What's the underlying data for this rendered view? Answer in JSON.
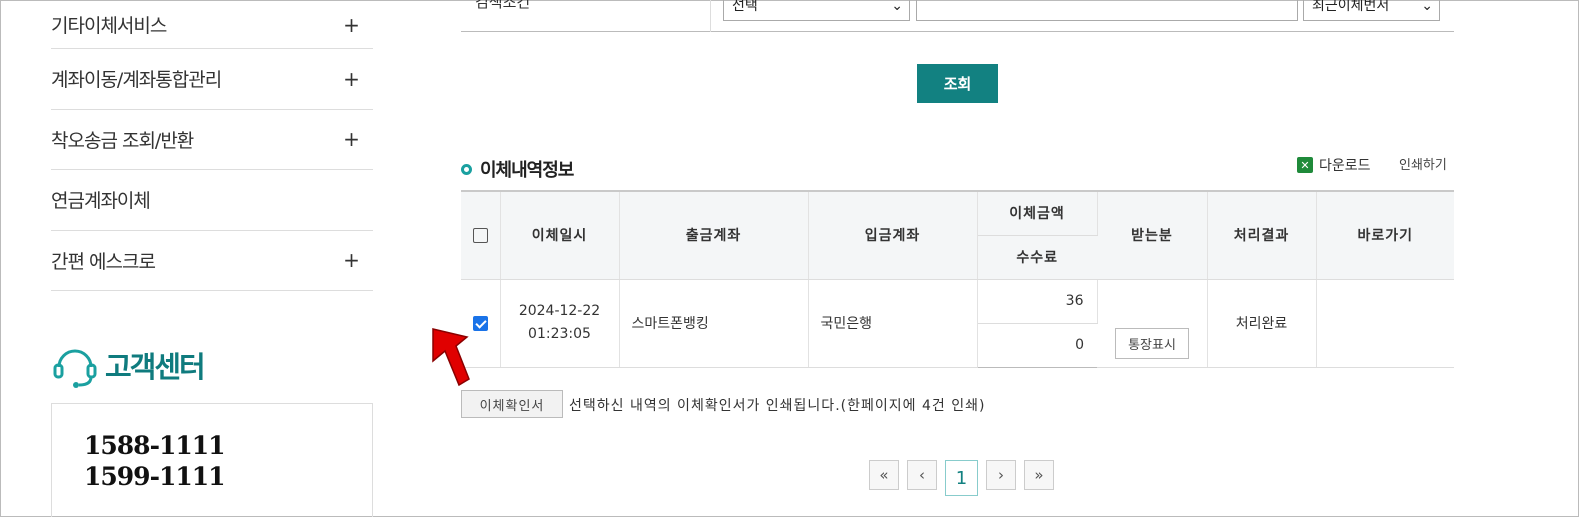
{
  "sidebar": {
    "items": [
      {
        "label": "기타이체서비스",
        "plus": "+"
      },
      {
        "label": "계좌이동/계좌통합관리",
        "plus": "+"
      },
      {
        "label": "착오송금 조회/반환",
        "plus": "+"
      },
      {
        "label": "연금계좌이체",
        "plus": ""
      },
      {
        "label": "간편 에스크로",
        "plus": "+"
      }
    ],
    "customer_center": {
      "title": "고객센터",
      "phones": [
        "1588-1111",
        "1599-1111"
      ]
    }
  },
  "search": {
    "label": "검색조건",
    "select1": "선택",
    "select2": "최근이체번서",
    "button": "조회"
  },
  "section": {
    "title": "이체내역정보",
    "download": "다운로드",
    "print": "인쇄하기"
  },
  "table": {
    "headers": {
      "date": "이체일시",
      "from": "출금계좌",
      "to": "입금계좌",
      "amount": "이체금액",
      "fee": "수수료",
      "recipient": "받는분",
      "result": "처리결과",
      "shortcut": "바로가기"
    },
    "rows": [
      {
        "date": "2024-12-22",
        "time": "01:23:05",
        "from": "스마트폰뱅킹",
        "to": "국민은행",
        "amount": "36",
        "fee": "0",
        "recipient_button": "통장표시",
        "result": "처리완료"
      }
    ]
  },
  "confirm": {
    "button": "이체확인서",
    "message": "선택하신 내역의 이체확인서가 인쇄됩니다.(한페이지에 4건 인쇄)"
  },
  "pager": {
    "first": "«",
    "prev": "‹",
    "current": "1",
    "next": "›",
    "last": "»"
  },
  "colors": {
    "accent": "#128181",
    "brand_text": "#0f7b7e",
    "arrow": "#e00000"
  }
}
